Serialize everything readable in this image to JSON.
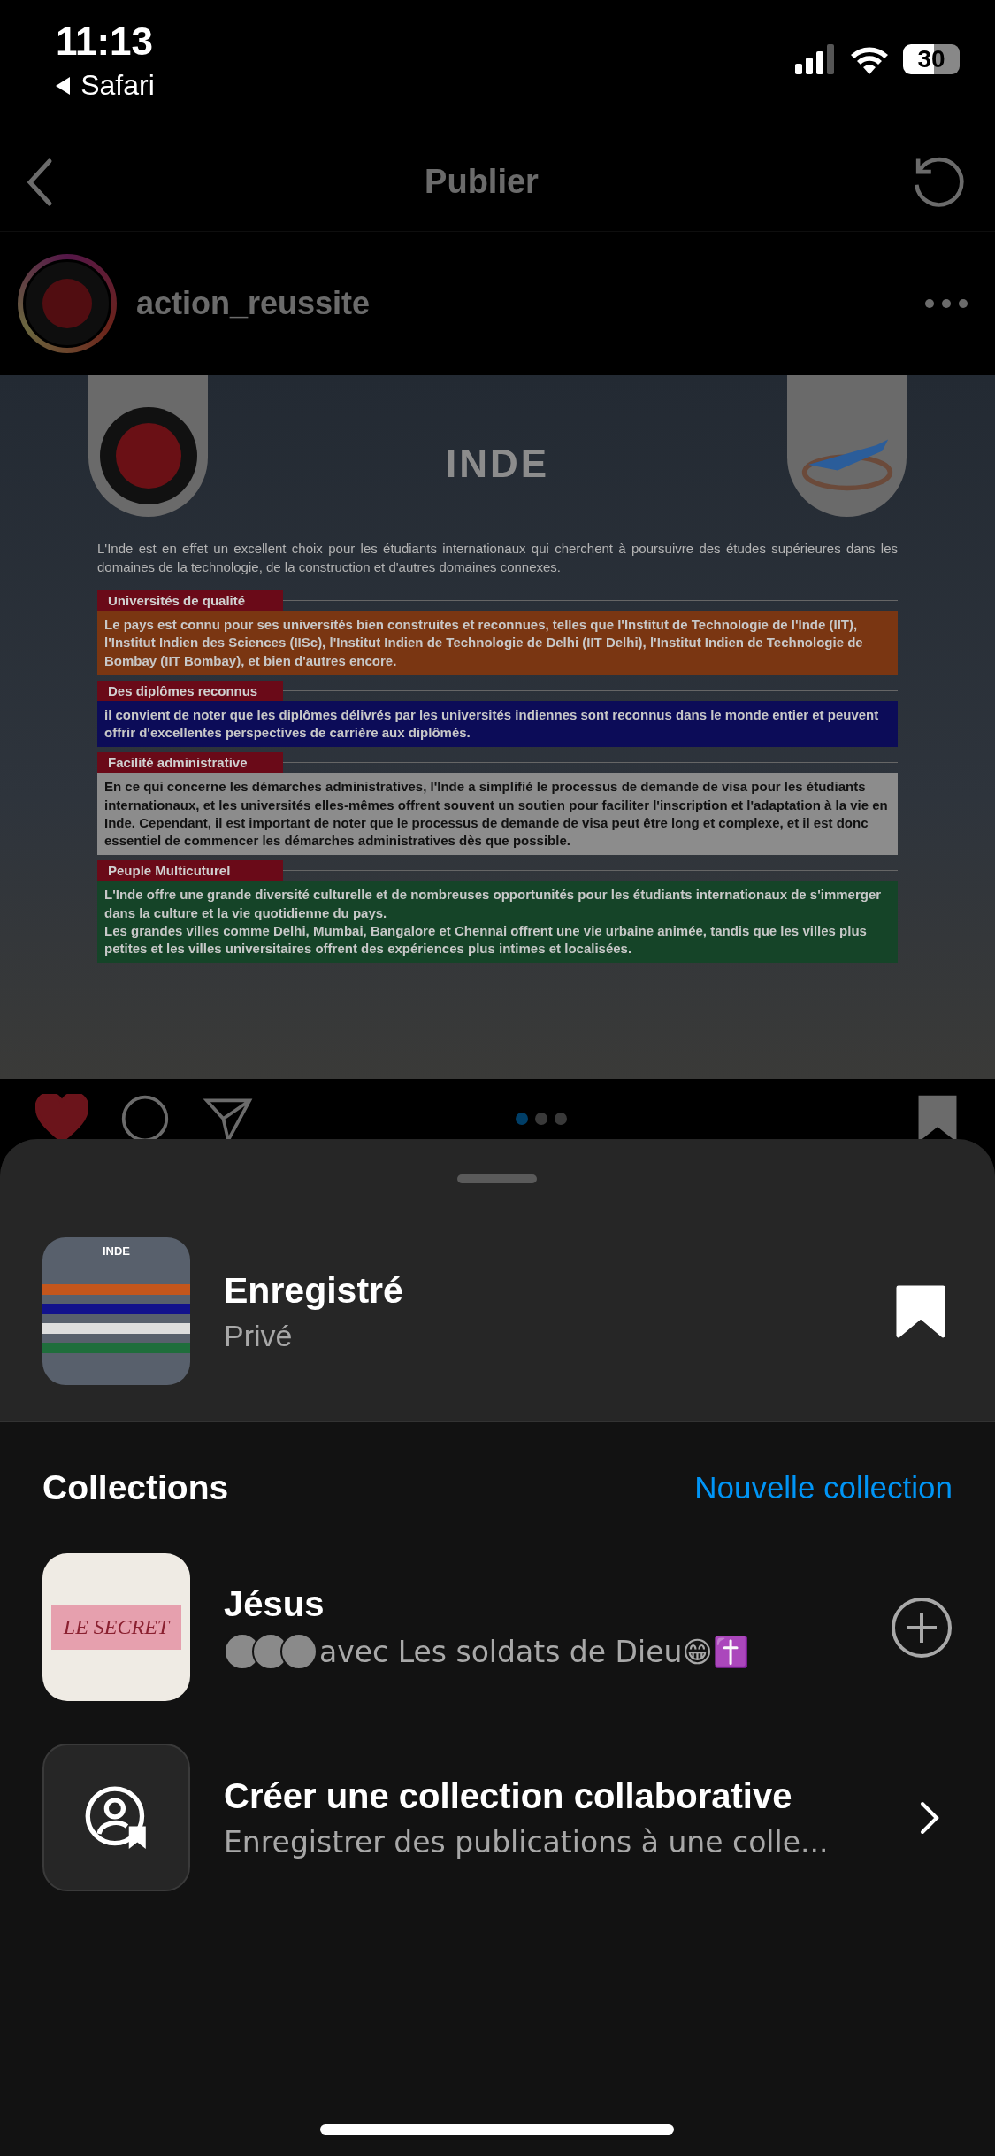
{
  "status_bar": {
    "time": "11:13",
    "back_app": "Safari",
    "battery": "30"
  },
  "nav": {
    "title": "Publier"
  },
  "post": {
    "username": "action_reussite",
    "liked": true,
    "graphic": {
      "title": "INDE",
      "intro": "L'Inde est en effet un excellent choix pour les étudiants internationaux qui cherchent à poursuivre des études supérieures dans les domaines de la technologie, de la construction et d'autres domaines connexes.",
      "sections": [
        {
          "heading": "Universités de qualité",
          "color": "#7a3612",
          "body": "Le pays est connu pour ses universités bien construites et reconnues, telles que l'Institut de Technologie de l'Inde (IIT), l'Institut Indien des Sciences (IISc), l'Institut Indien de Technologie de Delhi (IIT Delhi), l'Institut Indien de Technologie de Bombay (IIT Bombay), et bien d'autres encore."
        },
        {
          "heading": "Des diplômes reconnus",
          "color": "#0c0c58",
          "body": "il convient de noter que les diplômes délivrés par les universités indiennes sont reconnus dans le monde entier et peuvent offrir d'excellentes perspectives de carrière aux diplômés."
        },
        {
          "heading": "Facilité administrative",
          "color": "#8c8c8c",
          "body": "En ce qui concerne les démarches administratives, l'Inde a simplifié le processus de demande de visa pour les étudiants internationaux, et les universités elles-mêmes offrent souvent un soutien pour faciliter l'inscription et l'adaptation à la vie en Inde. Cependant, il est important de noter que le processus de demande de visa peut être long et complexe, et il est donc essentiel de commencer les démarches administratives dès que possible."
        },
        {
          "heading": "Peuple Multicuturel",
          "color": "#154428",
          "body": "L'Inde offre une grande diversité culturelle et de nombreuses opportunités pour les étudiants internationaux de s'immerger dans la culture et la vie quotidienne du pays.\nLes grandes villes comme Delhi, Mumbai, Bangalore et Chennai offrent une vie urbaine animée, tandis que les villes plus petites et les villes universitaires offrent des expériences plus intimes et localisées."
        }
      ]
    },
    "carousel_dots": [
      {
        "selected": true
      },
      {
        "selected": false
      },
      {
        "selected": false
      }
    ]
  },
  "sheet": {
    "saved": {
      "title": "Enregistré",
      "subtitle": "Privé",
      "thumbnail_title": "INDE",
      "saved": true
    },
    "collections_heading": "Collections",
    "new_collection": "Nouvelle collection",
    "collections": [
      {
        "kind": "collection",
        "name": "Jésus",
        "subtitle": "avec Les soldats de Dieu😁✝️",
        "cover_text": "LE SECRET"
      },
      {
        "kind": "create",
        "name": "Créer une collection collaborative",
        "subtitle": "Enregistrer des publications à une colle..."
      }
    ]
  }
}
